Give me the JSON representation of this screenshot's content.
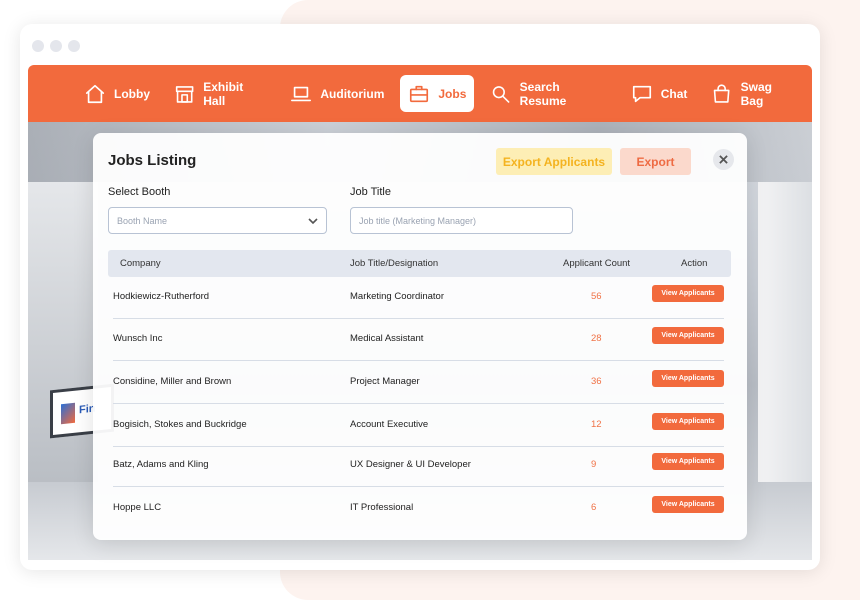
{
  "nav": {
    "items": [
      {
        "label": "Lobby",
        "icon": "home-icon"
      },
      {
        "label": "Exhibit Hall",
        "icon": "storefront-icon"
      },
      {
        "label": "Auditorium",
        "icon": "laptop-icon"
      },
      {
        "label": "Jobs",
        "icon": "briefcase-icon",
        "active": true
      },
      {
        "label": "Search Resume",
        "icon": "search-icon"
      },
      {
        "label": "Chat",
        "icon": "chat-bubble-icon"
      },
      {
        "label": "Swag Bag",
        "icon": "shopping-bag-icon"
      }
    ]
  },
  "background": {
    "screen_text": "Fin"
  },
  "modal": {
    "title": "Jobs Listing",
    "export_applicants_label": "Export Applicants",
    "export_label": "Export",
    "filters": {
      "booth_label": "Select Booth",
      "booth_placeholder": "Booth Name",
      "job_title_label": "Job Title",
      "job_title_placeholder": "Job title (Marketing Manager)"
    },
    "table": {
      "headers": {
        "company": "Company",
        "title": "Job Title/Designation",
        "count": "Applicant Count",
        "action": "Action"
      },
      "rows": [
        {
          "company": "Hodkiewicz-Rutherford",
          "title": "Marketing Coordinator",
          "count": "56",
          "action": "View Applicants"
        },
        {
          "company": "Wunsch Inc",
          "title": "Medical Assistant",
          "count": "28",
          "action": "View Applicants"
        },
        {
          "company": "Considine, Miller and Brown",
          "title": "Project Manager",
          "count": "36",
          "action": "View Applicants"
        },
        {
          "company": "Bogisich, Stokes and Buckridge",
          "title": "Account Executive",
          "count": "12",
          "action": "View Applicants"
        },
        {
          "company": "Batz, Adams and Kling",
          "title": "UX Designer & UI Developer",
          "count": "9",
          "action": "View Applicants"
        },
        {
          "company": "Hoppe LLC",
          "title": "IT Professional",
          "count": "6",
          "action": "View Applicants"
        }
      ]
    }
  },
  "colors": {
    "accent": "#f26a3d",
    "export_applicants_bg": "#fdeeb5",
    "export_applicants_text": "#f4b320",
    "export_bg": "#fbd9cc",
    "table_header_bg": "#e3e7ef"
  }
}
